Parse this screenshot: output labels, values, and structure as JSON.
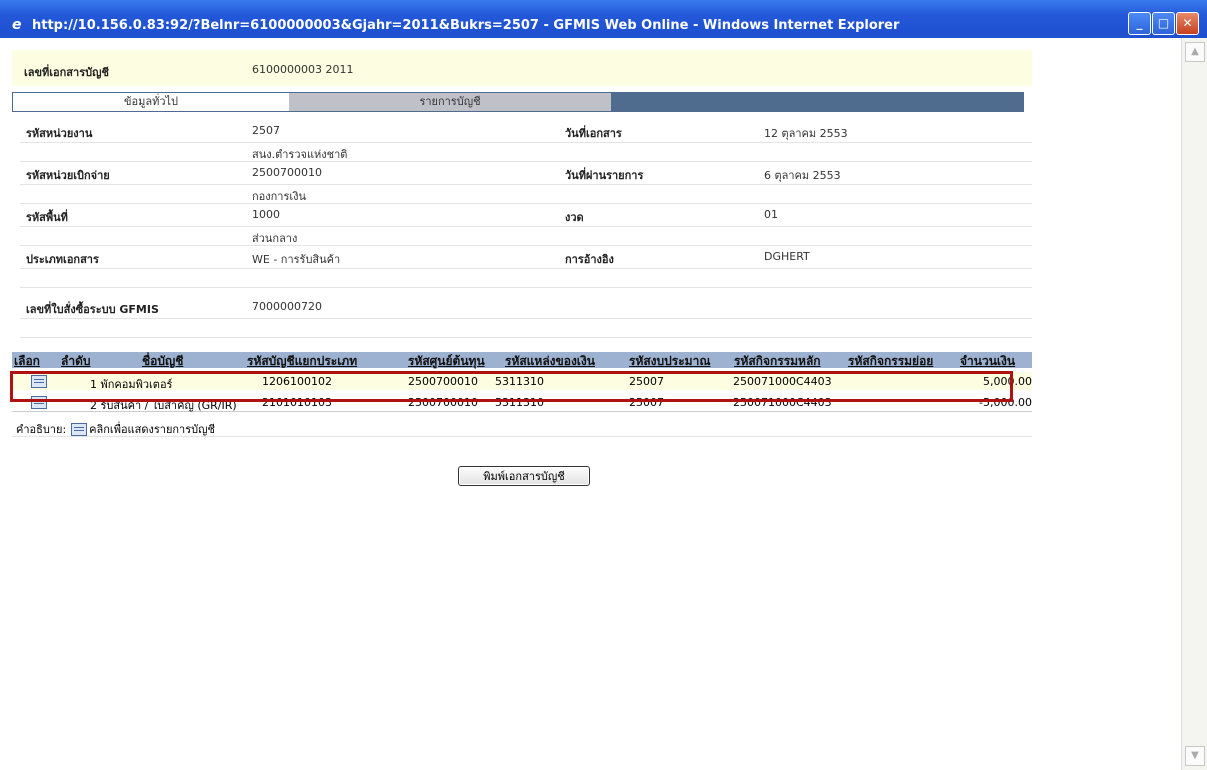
{
  "window": {
    "title": "http://10.156.0.83:92/?Belnr=6100000003&Gjahr=2011&Bukrs=2507 - GFMIS Web Online - Windows Internet Explorer"
  },
  "doc": {
    "label": "เลขที่เอกสารบัญชี",
    "value": "6100000003  2011"
  },
  "tabs": [
    {
      "label": "ข้อมูลทั่วไป"
    },
    {
      "label": "รายการบัญชี"
    }
  ],
  "fields": {
    "agency_code": {
      "label": "รหัสหน่วยงาน",
      "value": "2507",
      "sub": "สนง.ตำรวจแห่งชาติ"
    },
    "doc_date": {
      "label": "วันที่เอกสาร",
      "value": "12 ตุลาคม 2553"
    },
    "disb_unit": {
      "label": "รหัสหน่วยเบิกจ่าย",
      "value": "2500700010",
      "sub": "กองการเงิน"
    },
    "post_date": {
      "label": "วันที่ผ่านรายการ",
      "value": "6 ตุลาคม 2553"
    },
    "area_code": {
      "label": "รหัสพื้นที่",
      "value": "1000",
      "sub": "ส่วนกลาง"
    },
    "period": {
      "label": "งวด",
      "value": "01"
    },
    "doc_type": {
      "label": "ประเภทเอกสาร",
      "value": "WE - การรับสินค้า"
    },
    "reference": {
      "label": "การอ้างอิง",
      "value": "DGHERT"
    },
    "po_number": {
      "label": "เลขที่ใบสั่งซื้อระบบ GFMIS",
      "value": "7000000720"
    }
  },
  "grid": {
    "headers": [
      "เลือก",
      "ลำดับ",
      "ชื่อบัญชี",
      "รหัสบัญชีแยกประเภท",
      "รหัสศูนย์ต้นทุน",
      "รหัสแหล่งของเงิน",
      "รหัสงบประมาณ",
      "รหัสกิจกรรมหลัก",
      "รหัสกิจกรรมย่อย",
      "จำนวนเงิน"
    ],
    "rows": [
      {
        "seq_name": "1 พักคอมพิวเตอร์",
        "gl": "1206100102",
        "cost_center": "2500700010",
        "fund": "5311310",
        "budget": "25007",
        "activity": "250071000C4403",
        "amount": "5,000.00"
      },
      {
        "seq_name": "2 รับสินค้า / ใบสำคัญ (GR/IR)",
        "gl": "2101010103",
        "cost_center": "2500700010",
        "fund": "5311310",
        "budget": "25007",
        "activity": "250071000C4403",
        "amount": "-5,000.00"
      }
    ]
  },
  "legend": {
    "prefix": "คำอธิบาย:",
    "text": "คลิกเพื่อแสดงรายการบัญชี"
  },
  "print_button": "พิมพ์เอกสารบัญชี"
}
